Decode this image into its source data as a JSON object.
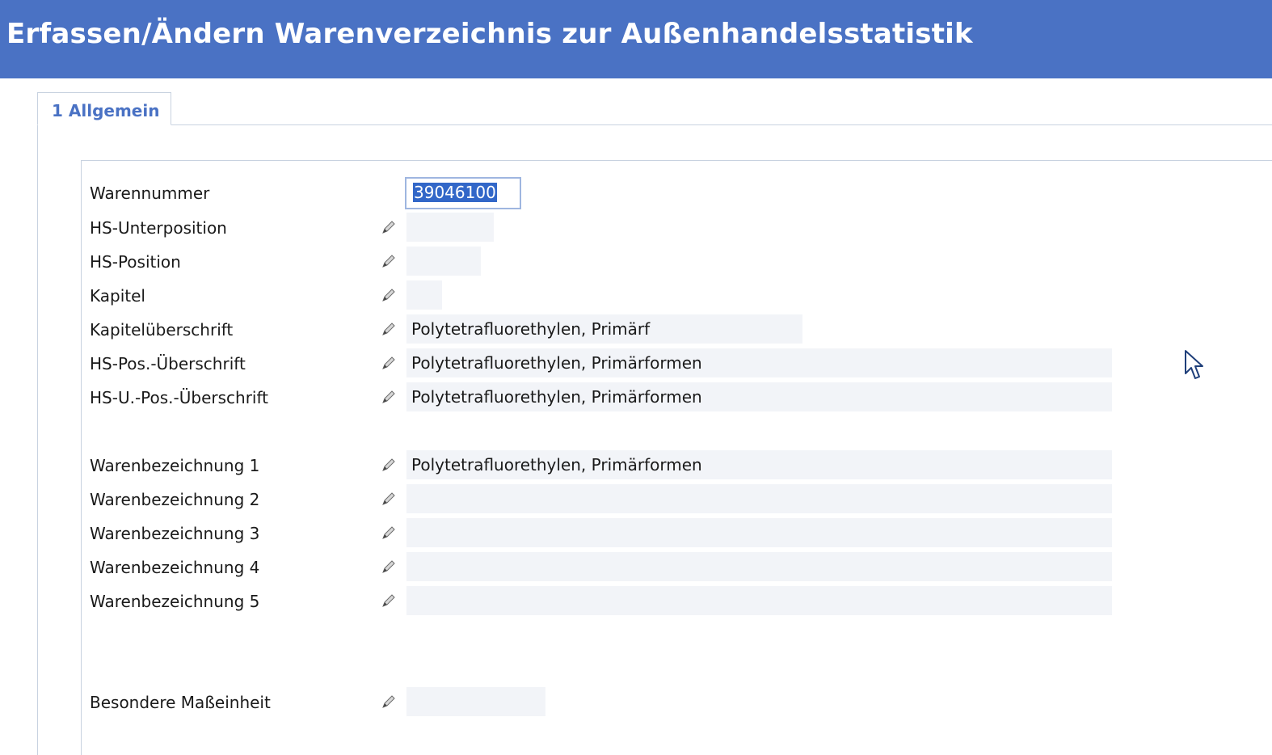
{
  "window": {
    "title": "Erfassen/Ändern Warenverzeichnis zur Außenhandelsstatistik"
  },
  "tabs": [
    {
      "label": "1 Allgemein",
      "active": true
    }
  ],
  "form": {
    "warennummer": {
      "label": "Warennummer",
      "value": "39046100"
    },
    "hs_unterposition": {
      "label": "HS-Unterposition",
      "value": ""
    },
    "hs_position": {
      "label": "HS-Position",
      "value": ""
    },
    "kapitel": {
      "label": "Kapitel",
      "value": ""
    },
    "kapitelueberschrift": {
      "label": "Kapitelüberschrift",
      "value": "Polytetrafluorethylen, Primärf"
    },
    "hs_pos_ueberschrift": {
      "label": "HS-Pos.-Überschrift",
      "value": "Polytetrafluorethylen, Primärformen"
    },
    "hs_u_pos_ueberschrift": {
      "label": "HS-U.-Pos.-Überschrift",
      "value": "Polytetrafluorethylen, Primärformen"
    },
    "warenbezeichnung_1": {
      "label": "Warenbezeichnung 1",
      "value": "Polytetrafluorethylen, Primärformen"
    },
    "warenbezeichnung_2": {
      "label": "Warenbezeichnung 2",
      "value": ""
    },
    "warenbezeichnung_3": {
      "label": "Warenbezeichnung 3",
      "value": ""
    },
    "warenbezeichnung_4": {
      "label": "Warenbezeichnung 4",
      "value": ""
    },
    "warenbezeichnung_5": {
      "label": "Warenbezeichnung 5",
      "value": ""
    },
    "besondere_masseinheit": {
      "label": "Besondere Maßeinheit",
      "value": ""
    }
  },
  "icons": {
    "edit": "pencil-icon",
    "cursor": "mouse-pointer-icon"
  },
  "colors": {
    "title_bar": "#4a72c4",
    "tab_text": "#4a72c4",
    "field_background": "#f2f4f8",
    "selection": "#3267c8"
  }
}
